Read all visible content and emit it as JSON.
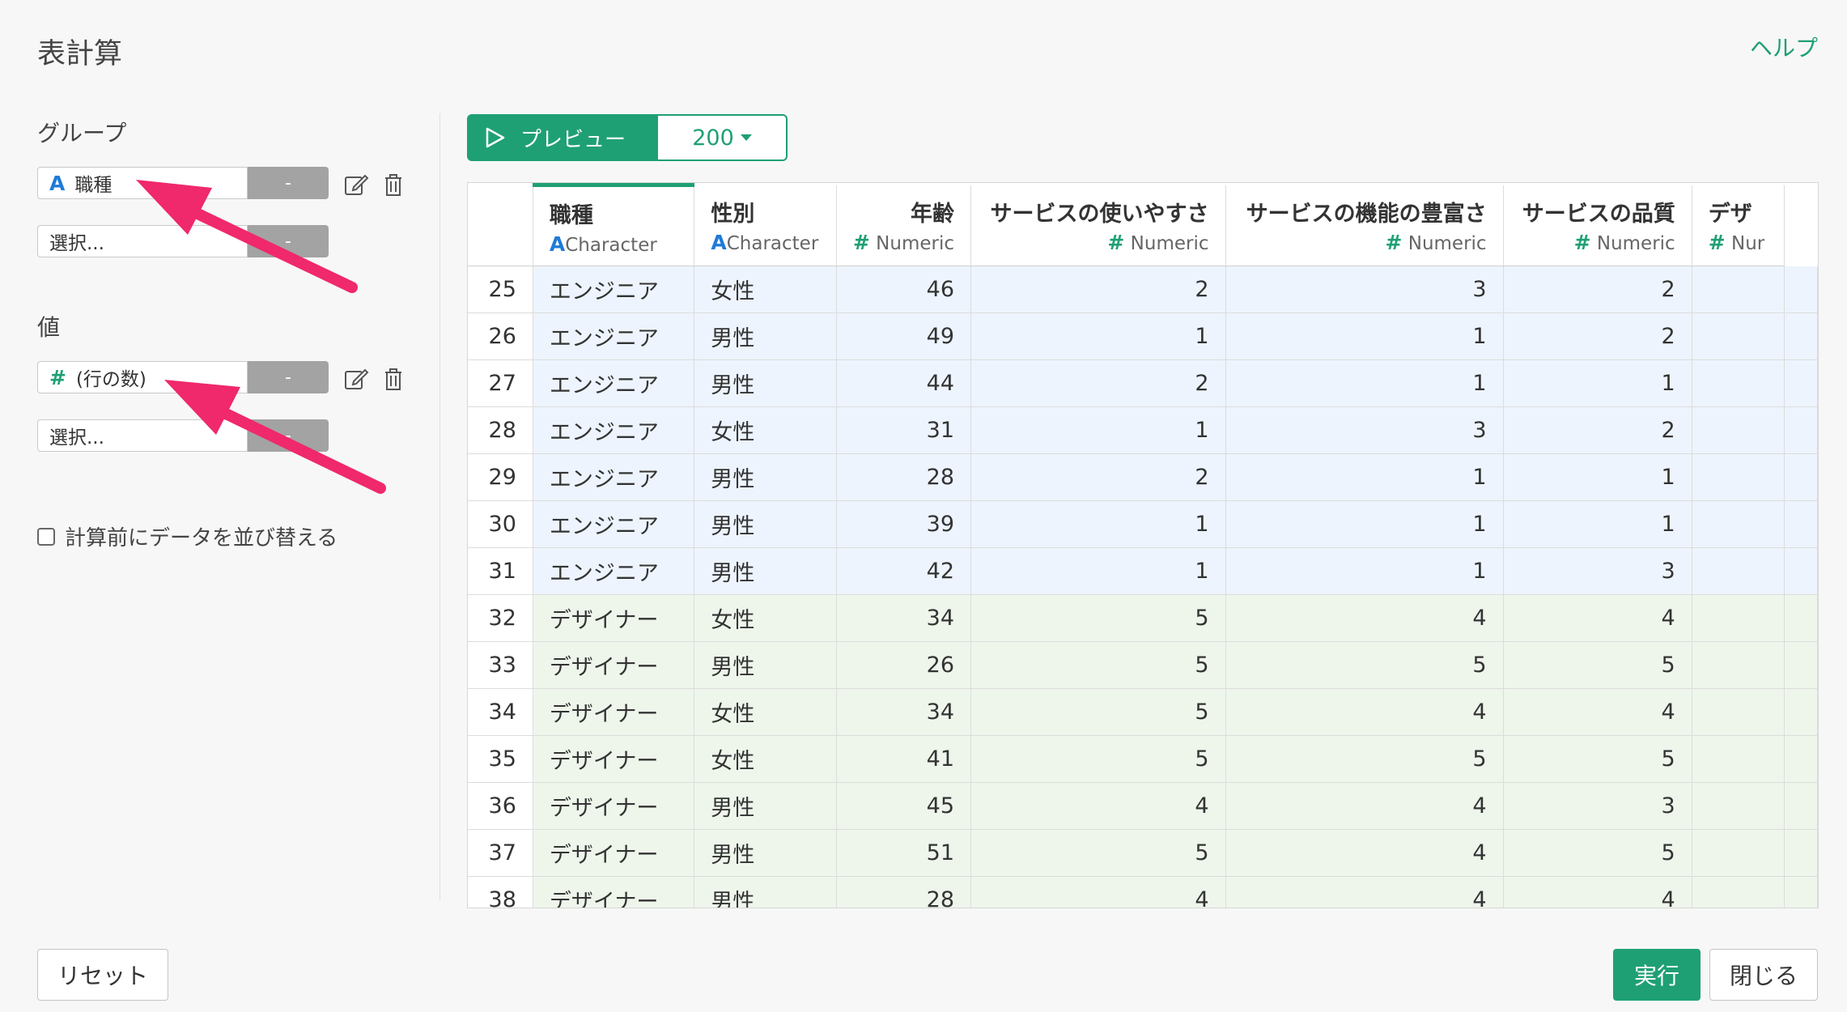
{
  "dialog": {
    "title": "表計算",
    "help_label": "ヘルプ"
  },
  "group": {
    "label": "グループ",
    "field": {
      "type_glyph": "A",
      "name": "職種",
      "dash": "-"
    },
    "select": {
      "placeholder": "選択...",
      "dash": "-"
    }
  },
  "value": {
    "label": "値",
    "field": {
      "type_glyph": "#",
      "name": "(行の数)",
      "dash": "-"
    },
    "select": {
      "placeholder": "選択...",
      "dash": "-"
    }
  },
  "sort_option": {
    "label": "計算前にデータを並び替える",
    "checked": false
  },
  "preview": {
    "button_label": "プレビュー",
    "count": "200"
  },
  "table": {
    "columns": [
      {
        "name": "職種",
        "type_glyph": "A",
        "type": "Character"
      },
      {
        "name": "性別",
        "type_glyph": "A",
        "type": "Character"
      },
      {
        "name": "年齢",
        "type_glyph": "#",
        "type": "Numeric"
      },
      {
        "name": "サービスの使いやすさ",
        "type_glyph": "#",
        "type": "Numeric"
      },
      {
        "name": "サービスの機能の豊富さ",
        "type_glyph": "#",
        "type": "Numeric"
      },
      {
        "name": "サービスの品質",
        "type_glyph": "#",
        "type": "Numeric"
      },
      {
        "name": "デザ",
        "type_glyph": "#",
        "type": "Nur"
      }
    ],
    "rows": [
      {
        "n": "25",
        "c": [
          "エンジニア",
          "女性",
          "46",
          "2",
          "3",
          "2",
          ""
        ],
        "group": 0
      },
      {
        "n": "26",
        "c": [
          "エンジニア",
          "男性",
          "49",
          "1",
          "1",
          "2",
          ""
        ],
        "group": 0
      },
      {
        "n": "27",
        "c": [
          "エンジニア",
          "男性",
          "44",
          "2",
          "1",
          "1",
          ""
        ],
        "group": 0
      },
      {
        "n": "28",
        "c": [
          "エンジニア",
          "女性",
          "31",
          "1",
          "3",
          "2",
          ""
        ],
        "group": 0
      },
      {
        "n": "29",
        "c": [
          "エンジニア",
          "男性",
          "28",
          "2",
          "1",
          "1",
          ""
        ],
        "group": 0
      },
      {
        "n": "30",
        "c": [
          "エンジニア",
          "男性",
          "39",
          "1",
          "1",
          "1",
          ""
        ],
        "group": 0
      },
      {
        "n": "31",
        "c": [
          "エンジニア",
          "男性",
          "42",
          "1",
          "1",
          "3",
          ""
        ],
        "group": 0
      },
      {
        "n": "32",
        "c": [
          "デザイナー",
          "女性",
          "34",
          "5",
          "4",
          "4",
          ""
        ],
        "group": 1
      },
      {
        "n": "33",
        "c": [
          "デザイナー",
          "男性",
          "26",
          "5",
          "5",
          "5",
          ""
        ],
        "group": 1
      },
      {
        "n": "34",
        "c": [
          "デザイナー",
          "女性",
          "34",
          "5",
          "4",
          "4",
          ""
        ],
        "group": 1
      },
      {
        "n": "35",
        "c": [
          "デザイナー",
          "女性",
          "41",
          "5",
          "5",
          "5",
          ""
        ],
        "group": 1
      },
      {
        "n": "36",
        "c": [
          "デザイナー",
          "男性",
          "45",
          "4",
          "4",
          "3",
          ""
        ],
        "group": 1
      },
      {
        "n": "37",
        "c": [
          "デザイナー",
          "男性",
          "51",
          "5",
          "4",
          "5",
          ""
        ],
        "group": 1
      },
      {
        "n": "38",
        "c": [
          "デザイナー",
          "男性",
          "28",
          "4",
          "4",
          "4",
          ""
        ],
        "group": 1
      }
    ]
  },
  "footer": {
    "reset_label": "リセット",
    "run_label": "実行",
    "close_label": "閉じる"
  },
  "colors": {
    "accent": "#1fa074",
    "annotation_arrow": "#f0286c",
    "character_type": "#1f7bd6"
  },
  "icons": {
    "edit": "edit-icon",
    "delete": "trash-icon",
    "play": "play-icon",
    "caret": "caret-down-icon"
  }
}
